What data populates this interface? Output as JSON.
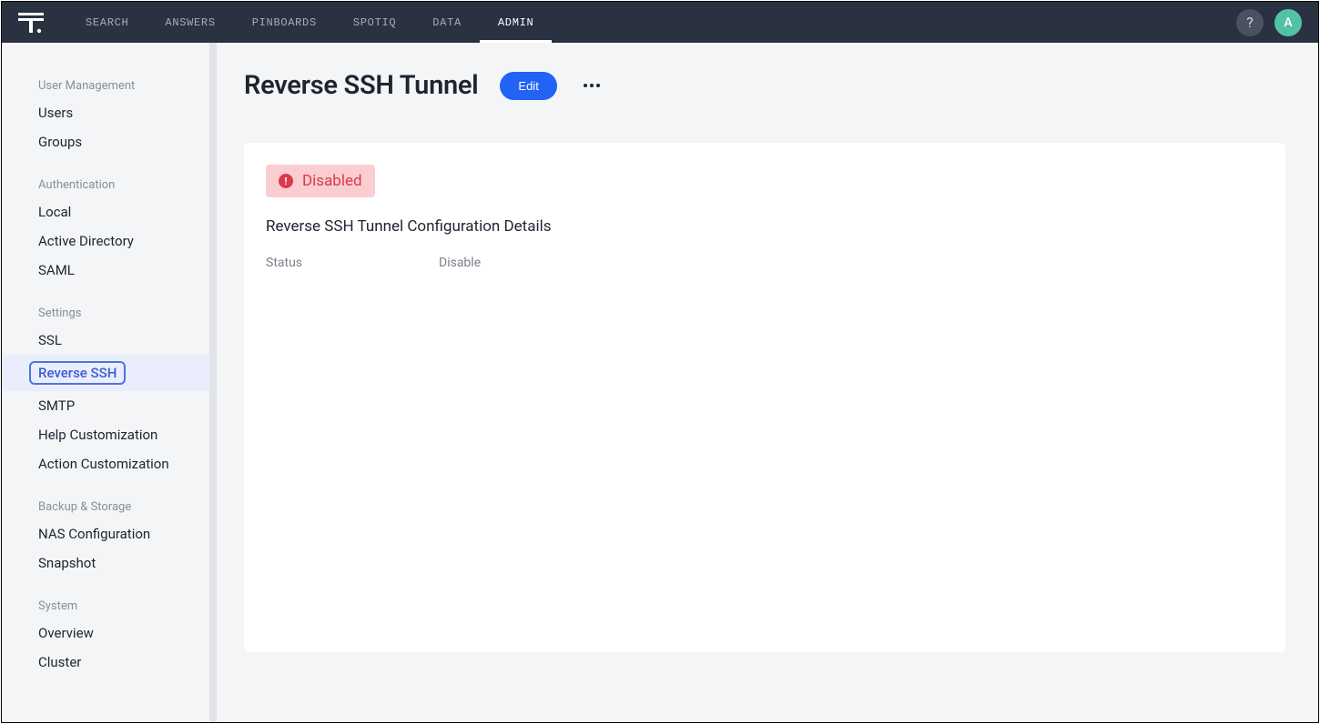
{
  "nav": {
    "items": [
      {
        "label": "SEARCH",
        "active": false
      },
      {
        "label": "ANSWERS",
        "active": false
      },
      {
        "label": "PINBOARDS",
        "active": false
      },
      {
        "label": "SPOTIQ",
        "active": false
      },
      {
        "label": "DATA",
        "active": false
      },
      {
        "label": "ADMIN",
        "active": true
      }
    ],
    "help_label": "?",
    "avatar_letter": "A"
  },
  "sidebar": {
    "sections": [
      {
        "header": "User Management",
        "items": [
          {
            "label": "Users",
            "selected": false
          },
          {
            "label": "Groups",
            "selected": false
          }
        ]
      },
      {
        "header": "Authentication",
        "items": [
          {
            "label": "Local",
            "selected": false
          },
          {
            "label": "Active Directory",
            "selected": false
          },
          {
            "label": "SAML",
            "selected": false
          }
        ]
      },
      {
        "header": "Settings",
        "items": [
          {
            "label": "SSL",
            "selected": false
          },
          {
            "label": "Reverse SSH",
            "selected": true
          },
          {
            "label": "SMTP",
            "selected": false
          },
          {
            "label": "Help Customization",
            "selected": false
          },
          {
            "label": "Action Customization",
            "selected": false
          }
        ]
      },
      {
        "header": "Backup & Storage",
        "items": [
          {
            "label": "NAS Configuration",
            "selected": false
          },
          {
            "label": "Snapshot",
            "selected": false
          }
        ]
      },
      {
        "header": "System",
        "items": [
          {
            "label": "Overview",
            "selected": false
          },
          {
            "label": "Cluster",
            "selected": false
          }
        ]
      }
    ]
  },
  "main": {
    "title": "Reverse SSH Tunnel",
    "edit_label": "Edit",
    "status_badge": {
      "icon": "!",
      "text": "Disabled"
    },
    "config_title": "Reverse SSH Tunnel Configuration Details",
    "details": {
      "status_label": "Status",
      "status_value": "Disable"
    }
  },
  "colors": {
    "topbar_bg": "#2a3140",
    "accent": "#2262f5",
    "danger": "#da3a4c",
    "avatar_bg": "#52c2a7"
  }
}
